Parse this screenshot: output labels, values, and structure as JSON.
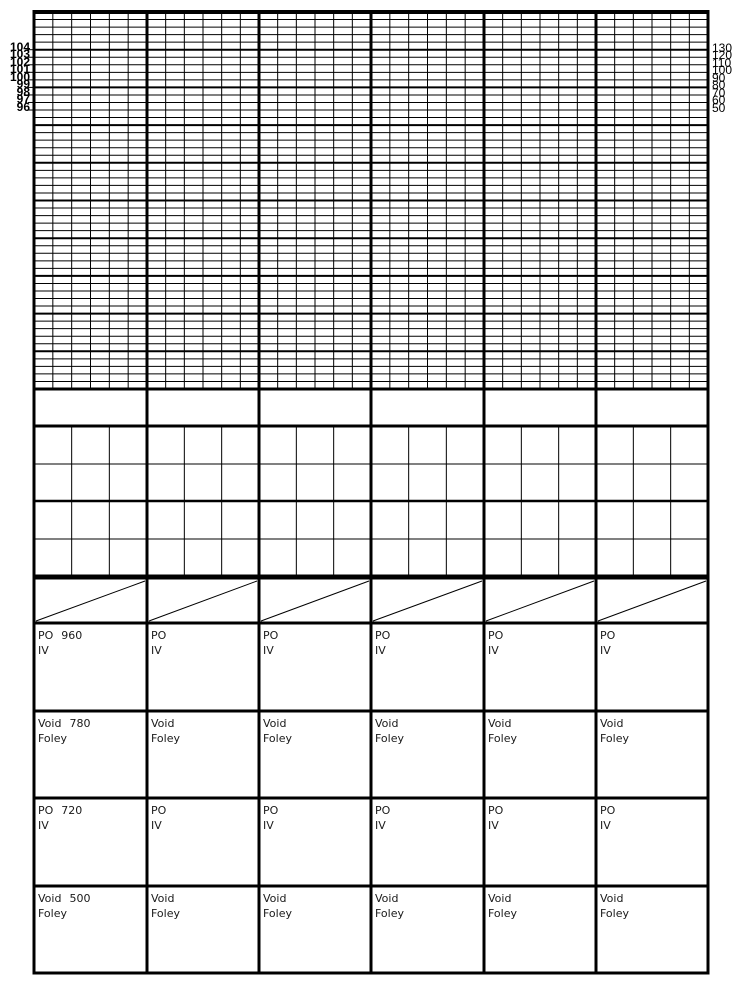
{
  "temperature_scale": [
    "104",
    "103",
    "102",
    "101",
    "100",
    "99",
    "98",
    "97",
    "96"
  ],
  "pulse_scale": [
    "130",
    "120",
    "110",
    "100",
    "90",
    "80",
    "70",
    "60",
    "50"
  ],
  "columns": 6,
  "intake_output_rows": [
    {
      "line1": "PO",
      "line2": "IV",
      "first_value": "960"
    },
    {
      "line1": "Void",
      "line2": "Foley",
      "first_value": "780"
    },
    {
      "line1": "PO",
      "line2": "IV",
      "first_value": "720"
    },
    {
      "line1": "Void",
      "line2": "Foley",
      "first_value": "500"
    }
  ]
}
